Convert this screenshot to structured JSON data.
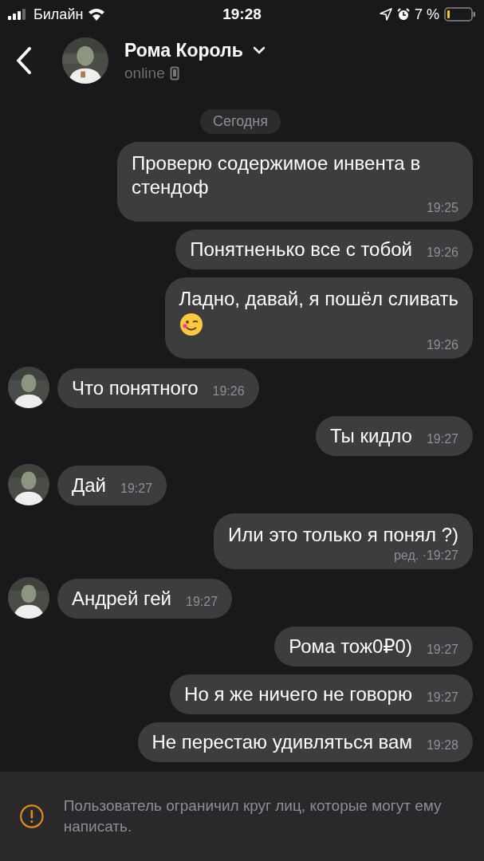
{
  "status_bar": {
    "carrier": "Билайн",
    "time": "19:28",
    "battery": "7 %"
  },
  "header": {
    "name": "Рома Король",
    "status": "online"
  },
  "date_pill": "Сегодня",
  "messages": [
    {
      "kind": "out",
      "text": "Проверю содержимое инвента в стендоф",
      "time": "19:25"
    },
    {
      "kind": "out",
      "text": "Понятненько все с тобой",
      "time": "19:26"
    },
    {
      "kind": "out",
      "text": "Ладно, давай, я пошёл сливать",
      "emoji": true,
      "time": "19:26"
    },
    {
      "kind": "in",
      "text": "Что понятного",
      "time": "19:26"
    },
    {
      "kind": "out",
      "text": "Ты кидло",
      "time": "19:27"
    },
    {
      "kind": "in",
      "text": "Дай",
      "time": "19:27"
    },
    {
      "kind": "out",
      "text": "Или это только я понял ?)",
      "edited": "ред. ·",
      "time": "19:27"
    },
    {
      "kind": "in",
      "text": "Андрей гей",
      "time": "19:27"
    },
    {
      "kind": "out",
      "text": "Рома тож0₽0)",
      "time": "19:27"
    },
    {
      "kind": "out",
      "text": "Но я же ничего не говорю",
      "time": "19:27"
    },
    {
      "kind": "out",
      "text": "Не перестаю удивляться вам",
      "time": "19:28"
    }
  ],
  "notice": "Пользователь ограничил круг лиц, которые могут ему написать."
}
